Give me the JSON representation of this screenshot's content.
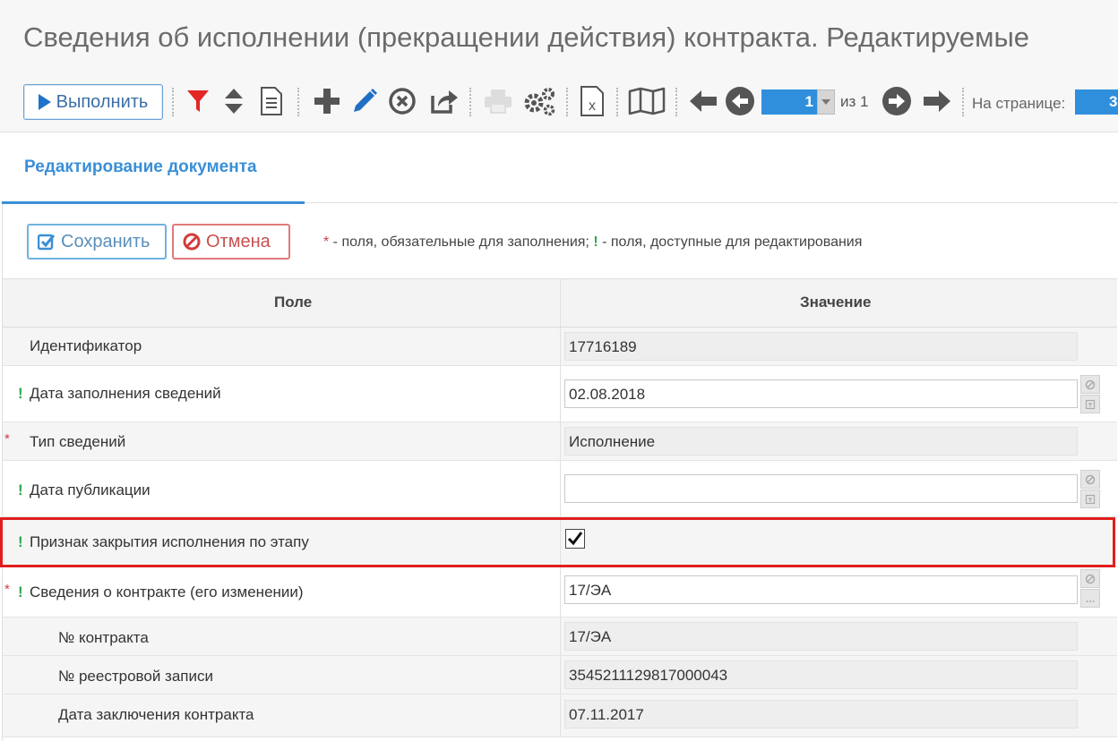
{
  "header": {
    "title": "Сведения об исполнении (прекращении действия) контракта. Редактируемые"
  },
  "toolbar": {
    "run_label": "Выполнить",
    "icons": [
      "filter-icon",
      "sort-icon",
      "document-icon",
      "add-icon",
      "edit-icon",
      "delete-icon",
      "share-icon",
      "print-icon",
      "settings-icon",
      "excel-icon",
      "map-icon",
      "arrow-left-icon",
      "circle-left-icon",
      "circle-right-icon",
      "arrow-right-icon"
    ],
    "page_current": "1",
    "page_of": "из 1",
    "per_page_label": "На странице:",
    "per_page_value": "3"
  },
  "tabs": [
    {
      "label": "Редактирование документа",
      "active": true
    }
  ],
  "form": {
    "save_label": "Сохранить",
    "cancel_label": "Отмена",
    "legend": {
      "req_mark": "*",
      "req_text": " - поля, обязательные для заполнения; ",
      "edit_mark": "!",
      "edit_text": " - поля, доступные для редактирования"
    },
    "columns": {
      "field": "Поле",
      "value": "Значение"
    },
    "rows": [
      {
        "label": "Идентификатор",
        "value": "17716189",
        "type": "readonly"
      },
      {
        "label": "Дата заполнения сведений",
        "value": "02.08.2018",
        "type": "editable-date",
        "editable": true
      },
      {
        "label": "Тип сведений",
        "value": "Исполнение",
        "type": "readonly",
        "required": true
      },
      {
        "label": "Дата публикации",
        "value": "",
        "type": "editable-date",
        "editable": true
      },
      {
        "label": "Признак закрытия исполнения по этапу",
        "value": "checked",
        "type": "checkbox",
        "editable": true
      },
      {
        "label": "Сведения о контракте (его изменении)",
        "value": "17/ЭА",
        "type": "editable-lookup",
        "editable": true,
        "required": true
      },
      {
        "label": "№ контракта",
        "value": "17/ЭА",
        "type": "readonly"
      },
      {
        "label": "№ реестровой записи",
        "value": "3545211129817000043",
        "type": "readonly"
      },
      {
        "label": "Дата заключения контракта",
        "value": "07.11.2017",
        "type": "readonly"
      }
    ]
  },
  "colors": {
    "accent": "#3a8fd6",
    "required": "#d23c3c",
    "editable": "#2fa84f",
    "highlight": "#e01e1e"
  }
}
